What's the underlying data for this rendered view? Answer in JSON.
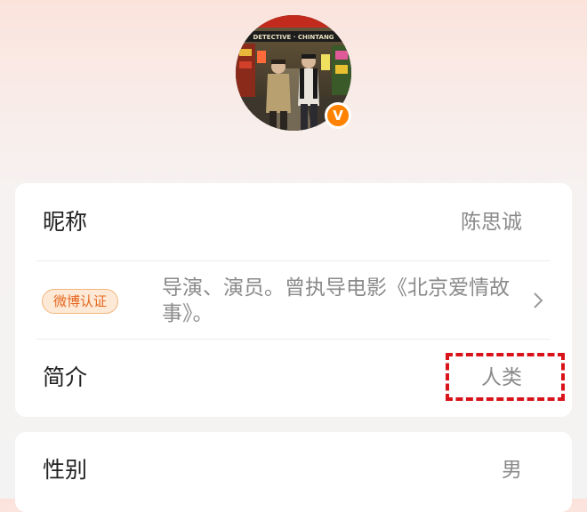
{
  "profile": {
    "avatar_icon": "movie-poster-avatar",
    "verified_icon": "verified-v-badge-icon",
    "verified_glyph": "V",
    "verified_color": "#ff8200",
    "poster_sign_text": "DETECTIVE · CHINTANG"
  },
  "info_card": {
    "nickname": {
      "label": "昵称",
      "value": "陈思诚"
    },
    "verification": {
      "badge_label": "微博认证",
      "text": "导演、演员。曾执导电影《北京爱情故事》。"
    },
    "bio": {
      "label": "简介",
      "value": "人类"
    }
  },
  "second_card": {
    "gender": {
      "label": "性别",
      "value": "男"
    }
  },
  "colors": {
    "annotation": "#d8141a",
    "badge_orange": "#e5671f"
  }
}
